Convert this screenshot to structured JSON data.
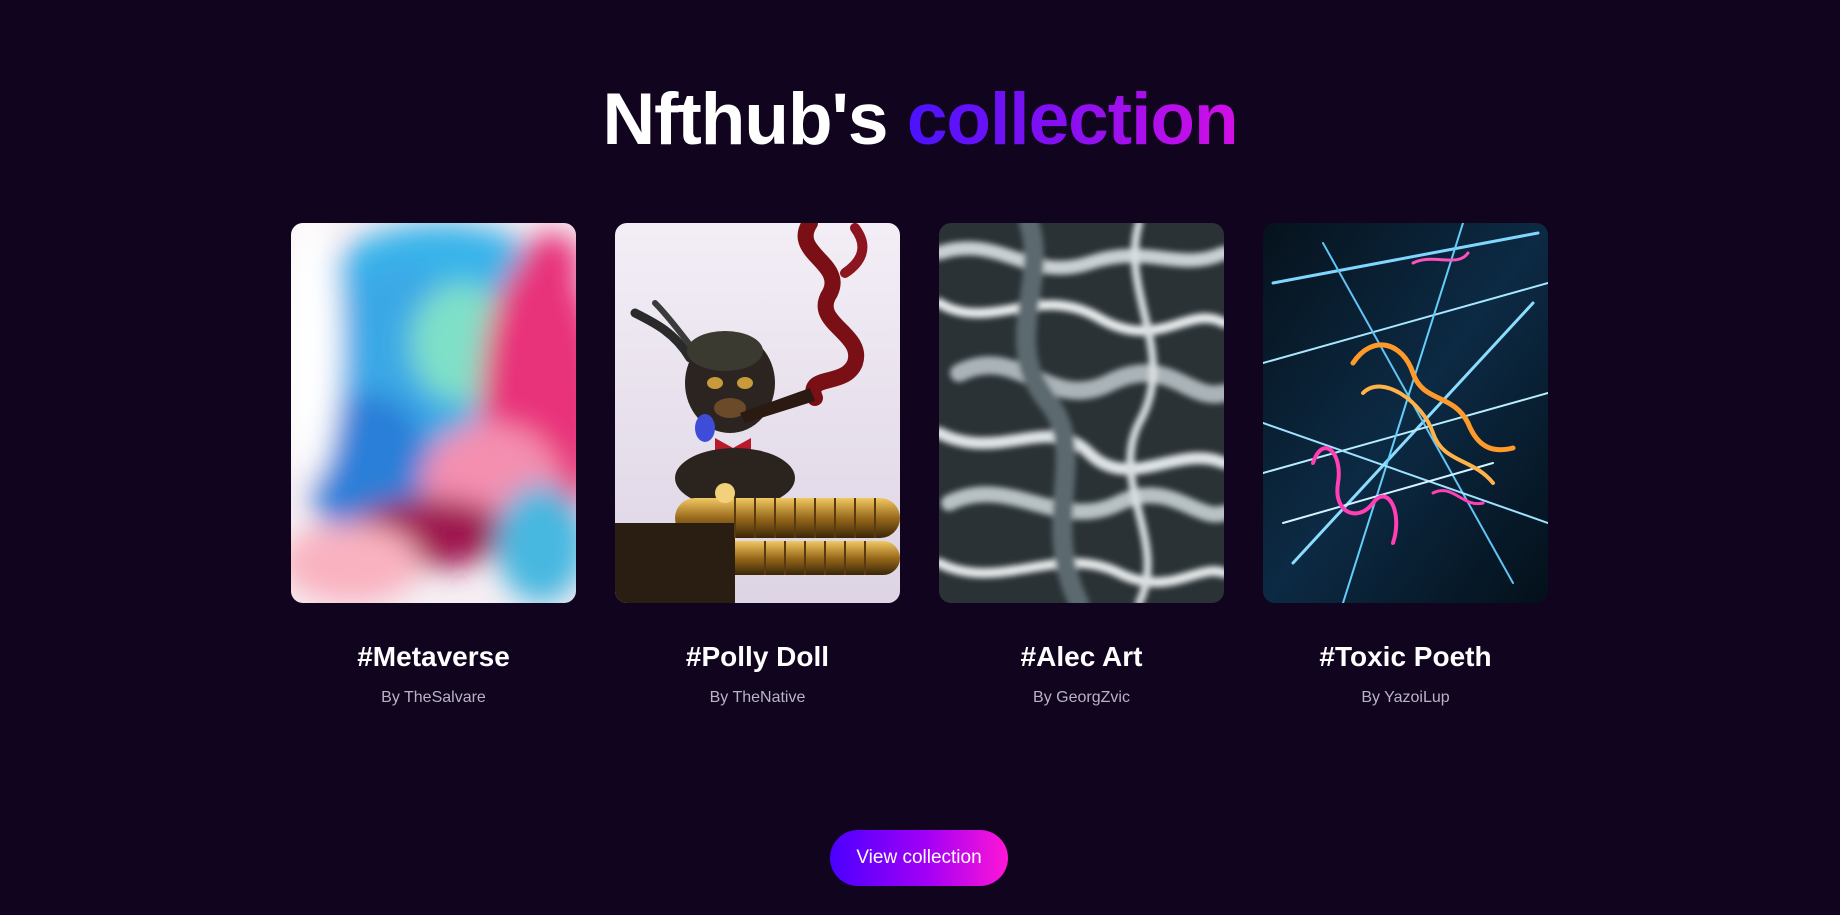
{
  "header": {
    "title_prefix": "Nfthub's",
    "title_accent": "collection"
  },
  "colors": {
    "background": "#10041e",
    "accent_start": "#4a12ff",
    "accent_end": "#d40ee6",
    "author_text": "#b9b3c4"
  },
  "collection": {
    "items": [
      {
        "title": "#Metaverse",
        "author": "By TheSalvare",
        "art": "pastel-abstract-painting"
      },
      {
        "title": "#Polly Doll",
        "author": "By TheNative",
        "art": "steampunk-figure-sculpture"
      },
      {
        "title": "#Alec Art",
        "author": "By GeorgZvic",
        "art": "liquid-metal-swirl"
      },
      {
        "title": "#Toxic Poeth",
        "author": "By YazoiLup",
        "art": "neon-lights"
      }
    ]
  },
  "cta": {
    "label": "View collection"
  }
}
